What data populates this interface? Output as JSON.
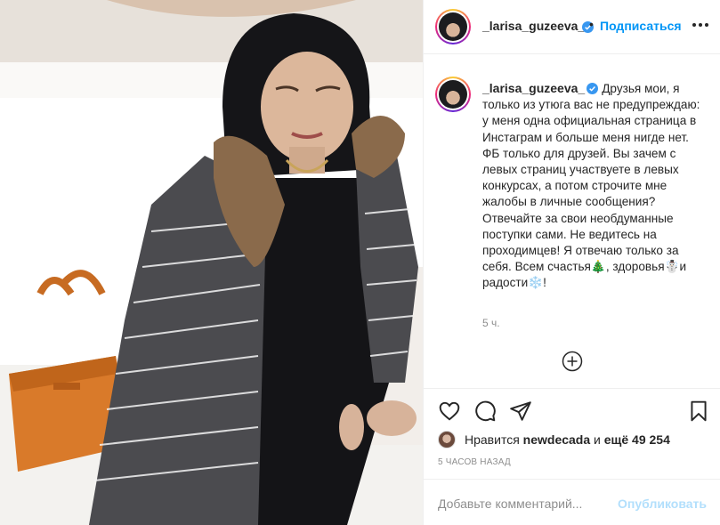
{
  "post": {
    "username": "_larisa_guzeeva_",
    "separator": "•",
    "follow_label": "Подписаться",
    "caption": "Друзья мои, я только из утюга вас не предупреждаю: у меня одна официальная страница в Инстаграм и больше меня нигде нет. ФБ только для друзей. Вы зачем с левых страниц участвуете в левых конкурсах, а потом строчите мне жалобы в личные сообщения? Отвечайте за свои необдуманные поступки сами. Не ведитесь на проходимцев! Я отвечаю только за себя. Всем счастья🎄, здоровья☃️и радости❄️!",
    "caption_time": "5 ч.",
    "likes_prefix": "Нравится",
    "likes_user": "newdecada",
    "likes_joiner": "и",
    "likes_count": "ещё 49 254",
    "posted_ago": "5 ЧАСОВ НАЗАД",
    "comment_placeholder": "Добавьте комментарий...",
    "post_label": "Опубликовать"
  },
  "icons": {
    "verified": "verified-badge-icon",
    "more": "more-options-icon",
    "load_more": "plus-circle-icon",
    "like": "heart-icon",
    "comment": "comment-icon",
    "share": "paper-plane-icon",
    "save": "bookmark-icon"
  },
  "colors": {
    "accent": "#0095f6",
    "verified": "#3897f0",
    "post_disabled": "#b2dffc",
    "muted": "#8e8e8e",
    "border": "#efefef"
  }
}
